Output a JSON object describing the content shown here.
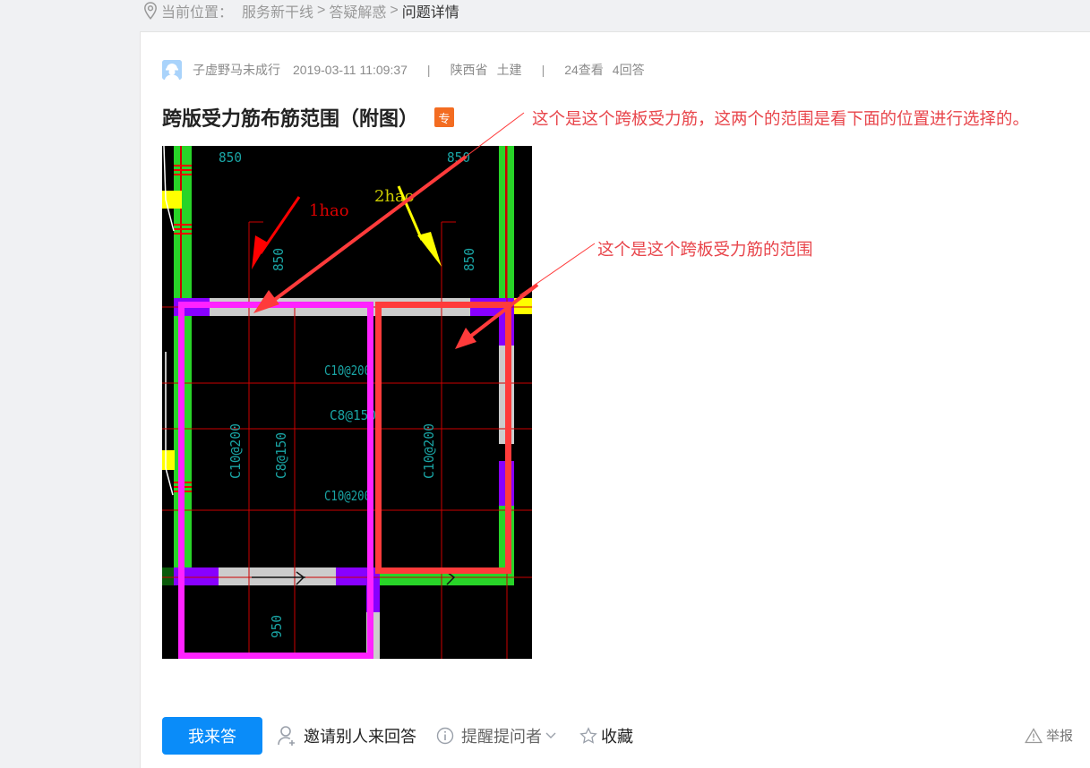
{
  "breadcrumb": {
    "label": "当前位置：",
    "items": [
      "服务新干线",
      "答疑解惑",
      "问题详情"
    ],
    "separator": ">"
  },
  "question": {
    "author": "子虚野马未成行",
    "datetime": "2019-03-11 11:09:37",
    "region": "陕西省",
    "category": "土建",
    "views": "24查看",
    "answers": "4回答",
    "title": "跨版受力筋布筋范围（附图）",
    "badge": "专",
    "badge_color": "#f36c21"
  },
  "drawing": {
    "dimension_labels": [
      "850",
      "850",
      "850",
      "850",
      "950"
    ],
    "markers": [
      "1hao",
      "2hao"
    ],
    "rebar_labels": [
      "C10@200",
      "C8@150",
      "C10@200",
      "C10@200",
      "C8@150",
      "C10@200"
    ],
    "highlight_colors": {
      "magenta_box": "#ff22ff",
      "red_box": "#ff3b3b",
      "marker_1": "#ff0000",
      "marker_2": "#ffff00"
    }
  },
  "annotations": {
    "note1": "这个是这个跨板受力筋，这两个的范围是看下面的位置进行选择的。",
    "note2": "这个是这个跨板受力筋的范围",
    "color": "#e8454b"
  },
  "actions": {
    "answer": "我来答",
    "invite": "邀请别人来回答",
    "remind": "提醒提问者",
    "favorite": "收藏",
    "report": "举报",
    "primary_color": "#0a8cf9"
  }
}
